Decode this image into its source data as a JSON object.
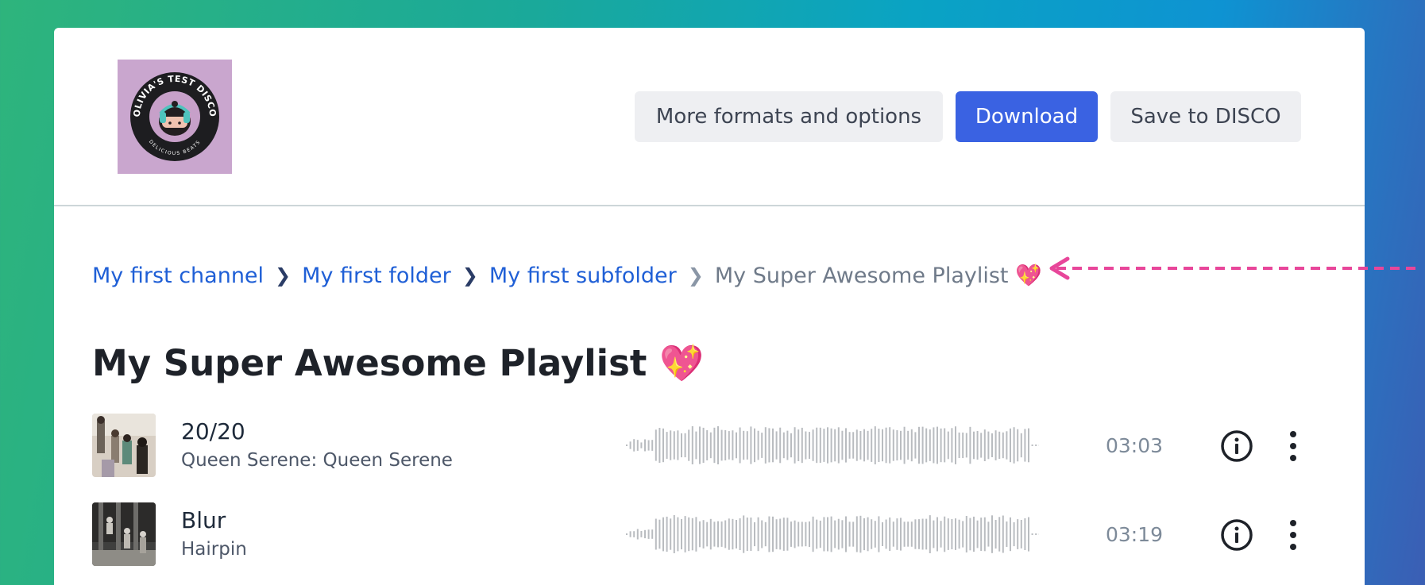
{
  "header": {
    "logo_alt": "OLIVIA'S TEST DISCO",
    "logo_text_top": "OLIVIA'S TEST DISCO",
    "logo_text_bottom": "DELICIOUS BEATS",
    "buttons": {
      "more_formats": "More formats and options",
      "download": "Download",
      "save": "Save to DISCO"
    }
  },
  "breadcrumb": {
    "items": [
      "My first channel",
      "My first folder",
      "My first subfolder"
    ],
    "current": "My Super Awesome Playlist 💖",
    "separator": "❯"
  },
  "playlist": {
    "title": "My Super Awesome Playlist 💖"
  },
  "tracks": [
    {
      "title": "20/20",
      "artist": "Queen Serene: Queen Serene",
      "duration": "03:03"
    },
    {
      "title": "Blur",
      "artist": "Hairpin",
      "duration": "03:19"
    }
  ],
  "colors": {
    "accent": "#3a62e2",
    "link": "#1f5fd6",
    "annotation": "#e8469a"
  },
  "icons": {
    "info": "info-circle-icon",
    "more": "more-vertical-icon"
  }
}
